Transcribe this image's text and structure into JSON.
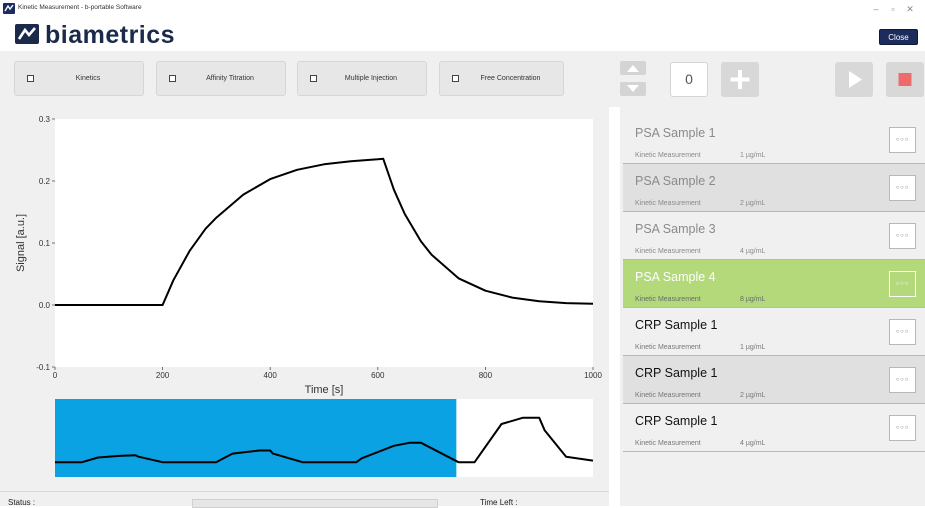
{
  "window": {
    "title": "Kinetic Measurement - b-portable Software",
    "minimize": "–",
    "maximize": "▫",
    "close": "✕"
  },
  "header": {
    "logo_text": "biametrics",
    "close_label": "Close"
  },
  "modes": [
    {
      "label": "Kinetics",
      "checked": false
    },
    {
      "label": "Affinity Titration",
      "checked": false
    },
    {
      "label": "Multiple Injection",
      "checked": false
    },
    {
      "label": "Free Concentration",
      "checked": false
    }
  ],
  "controls": {
    "counter_value": "0",
    "stop_color": "#ef6b6b"
  },
  "status": {
    "status_label": "Status :",
    "time_left_label": "Time Left :",
    "progress": 0
  },
  "samples": [
    {
      "title": "PSA Sample 1",
      "type": "Kinetic Measurement",
      "concentration": "1 µg/mL",
      "state": "pending",
      "menu": "○○○"
    },
    {
      "title": "PSA Sample 2",
      "type": "Kinetic Measurement",
      "concentration": "2 µg/mL",
      "state": "pending-alt",
      "menu": "○○○"
    },
    {
      "title": "PSA Sample 3",
      "type": "Kinetic Measurement",
      "concentration": "4 µg/mL",
      "state": "pending",
      "menu": "○○○"
    },
    {
      "title": "PSA Sample 4",
      "type": "Kinetic Measurement",
      "concentration": "8 µg/mL",
      "state": "active",
      "menu": "○○○"
    },
    {
      "title": "CRP Sample 1",
      "type": "Kinetic Measurement",
      "concentration": "1 µg/mL",
      "state": "queued",
      "menu": "○○○"
    },
    {
      "title": "CRP Sample 1",
      "type": "Kinetic Measurement",
      "concentration": "2 µg/mL",
      "state": "queued-alt",
      "menu": "○○○"
    },
    {
      "title": "CRP Sample 1",
      "type": "Kinetic Measurement",
      "concentration": "4 µg/mL",
      "state": "queued",
      "menu": "○○○"
    }
  ],
  "colors": {
    "active_sample": "#b3d97b",
    "overview_highlight": "#0aa2e3",
    "brand": "#1b2a4a"
  },
  "chart_data": [
    {
      "type": "line",
      "title": "",
      "xlabel": "Time [s]",
      "ylabel": "Signal [a.u.]",
      "xlim": [
        0,
        1000
      ],
      "ylim": [
        -0.1,
        0.3
      ],
      "x_ticks": [
        0,
        200,
        400,
        600,
        800,
        1000
      ],
      "y_ticks": [
        -0.1,
        0.0,
        0.1,
        0.2,
        0.3
      ],
      "x_tick_labels": [
        "0",
        "200",
        "400",
        "600",
        "800",
        "1000"
      ],
      "y_tick_labels": [
        "-0.1",
        "0.0",
        "0.1",
        "0.2",
        "0.3"
      ],
      "grid": false,
      "series": [
        {
          "x": [
            0,
            200,
            220,
            250,
            280,
            300,
            350,
            400,
            450,
            500,
            550,
            600,
            610,
            630,
            650,
            680,
            700,
            750,
            800,
            850,
            900,
            950,
            1000
          ],
          "y": [
            0.0,
            0.0,
            0.04,
            0.087,
            0.123,
            0.141,
            0.178,
            0.203,
            0.218,
            0.227,
            0.232,
            0.235,
            0.236,
            0.186,
            0.147,
            0.103,
            0.081,
            0.043,
            0.023,
            0.012,
            0.006,
            0.003,
            0.002
          ]
        }
      ]
    },
    {
      "type": "line",
      "title": "",
      "xlabel": "",
      "ylabel": "",
      "xlim": [
        0,
        10
      ],
      "ylim": [
        0,
        1
      ],
      "grid": false,
      "highlight_range": [
        0,
        7.46
      ],
      "series": [
        {
          "x": [
            0,
            0.5,
            0.55,
            0.8,
            1.2,
            1.5,
            1.55,
            2.0,
            2.5,
            3.0,
            3.05,
            3.3,
            3.8,
            4.0,
            4.05,
            4.6,
            5.5,
            5.6,
            5.7,
            6.3,
            6.6,
            6.8,
            7.5,
            7.8,
            7.85,
            8.3,
            8.7,
            9.0,
            9.1,
            9.5,
            10.0
          ],
          "y": [
            0.19,
            0.19,
            0.2,
            0.25,
            0.27,
            0.28,
            0.26,
            0.19,
            0.19,
            0.19,
            0.21,
            0.3,
            0.34,
            0.34,
            0.3,
            0.19,
            0.19,
            0.19,
            0.24,
            0.4,
            0.44,
            0.44,
            0.19,
            0.19,
            0.24,
            0.68,
            0.76,
            0.76,
            0.6,
            0.26,
            0.21
          ]
        }
      ]
    }
  ]
}
